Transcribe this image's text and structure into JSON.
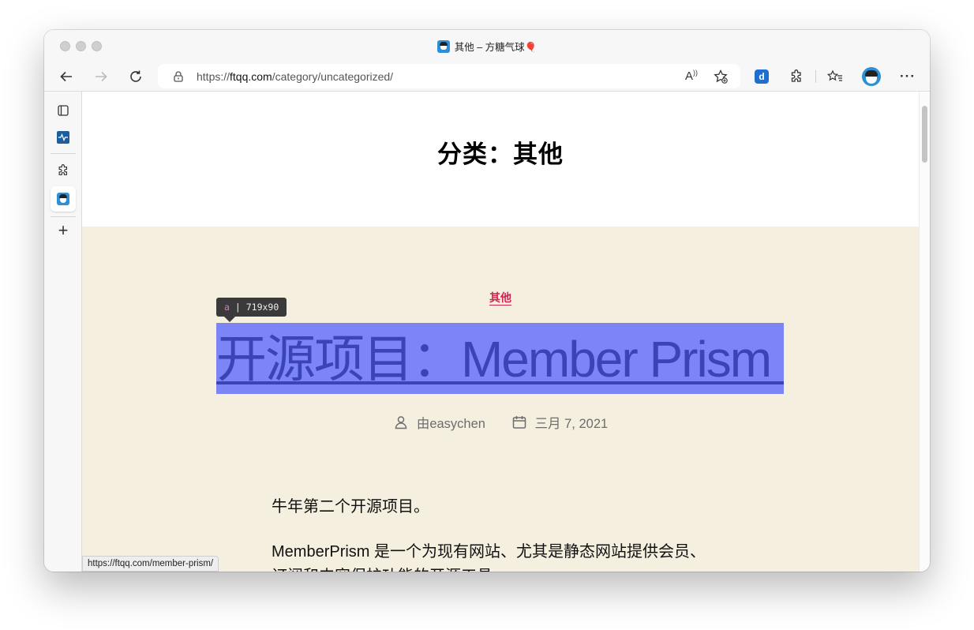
{
  "window": {
    "tab_title": "其他 – 方糖气球",
    "tab_emoji": "🎈"
  },
  "toolbar": {
    "url_prefix": "https://",
    "url_host": "ftqq.com",
    "url_path": "/category/uncategorized/",
    "back_icon": "←",
    "forward_icon": "→",
    "refresh_icon": "↻",
    "read_aloud_icon": "A",
    "favorite_add_icon": "☆",
    "extensions_icon": "puzzle",
    "favorites_icon": "☆≡",
    "more_icon": "···"
  },
  "sidebar": {
    "add_icon": "+"
  },
  "page": {
    "archive_title": "分类：其他",
    "category_label": "其他",
    "tooltip_tag": "a",
    "tooltip_size": "719x90",
    "post_title": "开源项目：Member Prism",
    "author": "由easychen",
    "date": "三月 7, 2021",
    "paragraph1": "牛年第二个开源项目。",
    "paragraph2": "MemberPrism 是一个为现有网站、尤其是静态网站提供会员、订阅和内容保护功能的开源工具。"
  },
  "status_bar": {
    "hover_url": "https://ftqq.com/member-prism/"
  },
  "colors": {
    "category_accent": "#cd2653",
    "post_area_bg": "#f5efe0",
    "highlight_overlay": "#7b85f5",
    "link_text": "#3a44b4"
  }
}
